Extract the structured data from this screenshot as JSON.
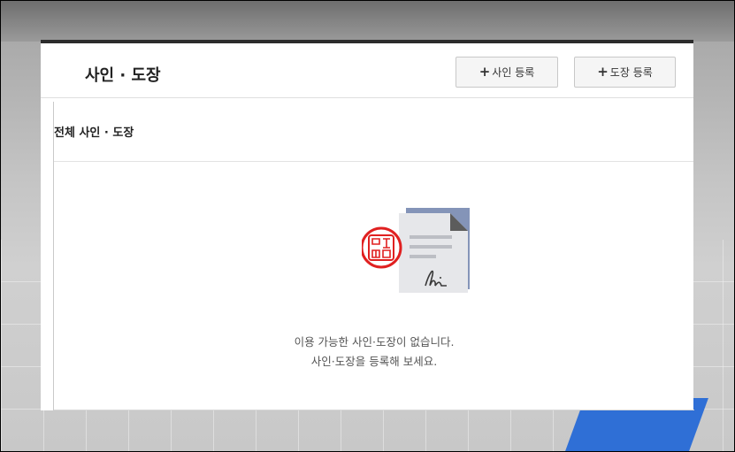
{
  "header": {
    "title": "사인 · 도장",
    "add_sign_label": "사인 등록",
    "add_stamp_label": "도장 등록"
  },
  "section": {
    "title": "전체 사인 · 도장"
  },
  "empty_state": {
    "line1": "이용 가능한 사인·도장이 없습니다.",
    "line2": "사인·도장을 등록해 보세요.",
    "illustration": "document-with-signature-and-stamp-icon"
  },
  "colors": {
    "header_border": "#2c2c2c",
    "stamp_red": "#e02020",
    "doc_blue": "#7f8fb5"
  }
}
